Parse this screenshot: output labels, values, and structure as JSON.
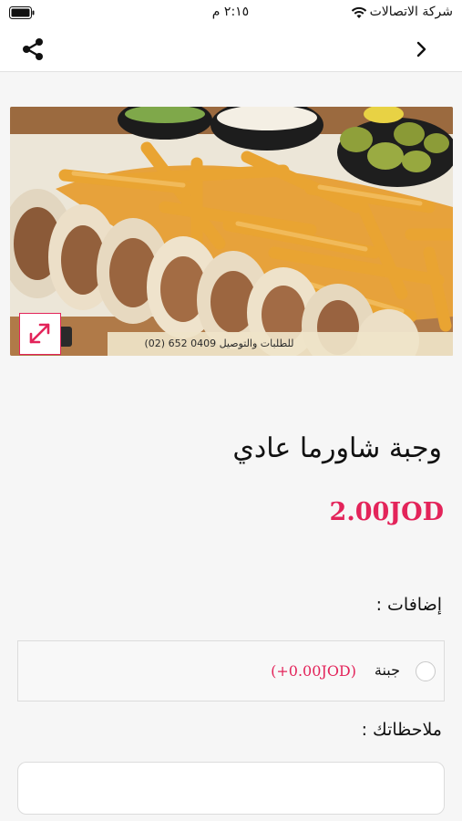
{
  "status_bar": {
    "carrier": "شركة الاتصالات",
    "time": "٢:١٥ م"
  },
  "nav": {
    "share_icon": "share-icon",
    "back_icon": "chevron-right-icon"
  },
  "product": {
    "image_banner_text": "للطلبات والتوصيل 0409 652 (02)",
    "title": "وجبة شاورما عادي",
    "price": "2.00JOD"
  },
  "extras": {
    "heading": "إضافات :",
    "items": [
      {
        "name": "جبنة",
        "price": "(+0.00JOD)",
        "selected": false
      }
    ]
  },
  "notes": {
    "heading": "ملاحظاتك :",
    "placeholder": "",
    "value": ""
  },
  "colors": {
    "accent": "#e3245a"
  }
}
